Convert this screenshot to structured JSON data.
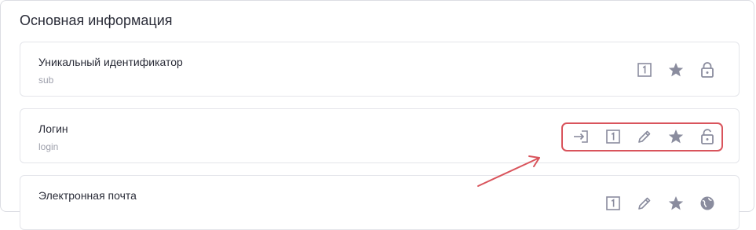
{
  "section": {
    "title": "Основная информация"
  },
  "fields": [
    {
      "label": "Уникальный идентификатор",
      "key": "sub",
      "icons": [
        "one-square-icon",
        "star-icon",
        "lock-icon"
      ]
    },
    {
      "label": "Логин",
      "key": "login",
      "icons": [
        "login-arrow-icon",
        "one-square-icon",
        "pencil-icon",
        "star-icon",
        "unlock-icon"
      ]
    },
    {
      "label": "Электронная почта",
      "key": "",
      "icons": [
        "one-square-icon",
        "pencil-icon",
        "star-icon",
        "globe-icon"
      ]
    }
  ],
  "colors": {
    "icon": "#8a8c9e",
    "highlight": "#d9545c",
    "text": "#2a2c38",
    "muted": "#9ea0ac"
  }
}
